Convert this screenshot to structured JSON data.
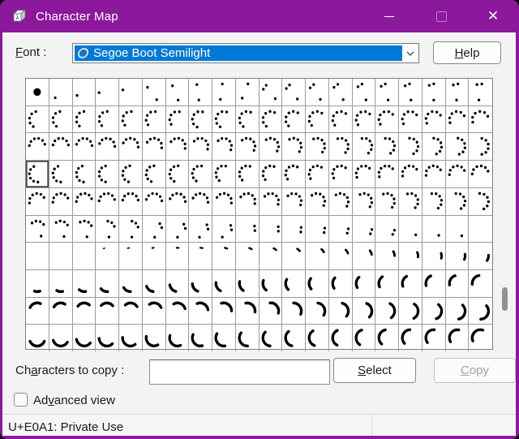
{
  "titlebar": {
    "title": "Character Map",
    "minimize_glyph": "–",
    "close_glyph": "✕"
  },
  "font_row": {
    "label": {
      "pre": "",
      "key": "F",
      "post": "ont :"
    },
    "combo_value": "Segoe Boot Semilight",
    "help_button": {
      "pre": "",
      "key": "H",
      "post": "elp"
    }
  },
  "colors": {
    "accent": "#8C199C",
    "selection_highlight": "#0078D7",
    "glyph": "#000000"
  },
  "grid": {
    "columns": 20,
    "rows": 10,
    "selected_index": 60,
    "cells": [
      "B",
      "d:225",
      "d:245",
      "d:265",
      "d:285",
      "d:305,160",
      "d:320,175",
      "d:335,190",
      "d:350,205",
      "d:5,220",
      "d:290,325,145",
      "d:295,330,150",
      "d:300,335,155",
      "d:305,340,160",
      "d:310,345,165",
      "d:315,350,170",
      "d:320,355,175",
      "d:325,0,180",
      "d:330,5,185",
      "d:335,10,190",
      "d:350,315,280,245,210",
      "d:354,319,284,249,214",
      "d:358,323,288,253,218",
      "d:2,327,292,257,222",
      "d:6,331,296,261,226",
      "d:10,335,300,265,230",
      "d:14,339,304,269,234",
      "d:18,343,308,273,238,203",
      "d:22,347,312,277,242,207",
      "d:26,351,316,281,246,211",
      "d:30,355,320,285,250,215",
      "d:34,359,324,289,254,219",
      "d:38,3,328,293,258,223",
      "d:42,7,332,297,262,227",
      "d:46,11,336,301,266,231",
      "d:50,15,340,305,270,235",
      "d:54,19,344,309,274,239",
      "d:58,23,348,313,278,243",
      "d:62,27,352,317,282,247",
      "d:66,31,356,321,286,251",
      "d:75,43,11,339,307,275",
      "d:80,48,16,344,312,280",
      "d:85,53,21,349,317,285",
      "d:90,58,26,354,322,290",
      "d:95,63,31,359,327,295",
      "d:100,68,36,4,332,300",
      "d:105,73,41,9,337,305",
      "d:110,78,46,14,342,310",
      "d:115,83,51,19,347,315",
      "d:120,88,56,24,352,320",
      "d:125,93,61,29,357,325",
      "d:130,98,66,34,2,330",
      "d:135,103,71,39,7,335",
      "d:140,108,76,44,12,340",
      "d:145,113,81,49,17,345",
      "d:150,118,86,54,22,350",
      "d:155,123,91,59,27,355",
      "d:160,128,96,64,32,0",
      "d:165,133,101,69,37,5",
      "d:170,138,106,74,42,10",
      "d:335,303,271,239,207,175",
      "d:340,308,276,244,212,180",
      "d:345,313,281,249,217,185",
      "d:350,318,286,254,222,190",
      "d:355,323,291,259,227,195",
      "d:0,328,296,264,232,200",
      "d:5,333,301,269,237,205",
      "d:10,338,306,274,242,210",
      "d:15,343,311,279,247,215",
      "d:20,348,316,284,252,220",
      "d:25,353,321,289,257,225",
      "d:30,358,326,294,262,230",
      "d:35,3,331,299,267,235",
      "d:40,8,336,304,272,240",
      "d:45,13,341,309,277,245",
      "d:50,18,346,314,282,250",
      "d:55,23,351,319,287,255",
      "d:60,28,356,324,292,260",
      "d:65,33,1,329,297,265",
      "d:70,38,6,334,302,270",
      "d:60,28,356,324,292,260",
      "d:65,33,1,329,297,265",
      "d:70,38,6,334,302,270",
      "d:75,43,11,339,307,275",
      "d:80,48,16,344,312,280",
      "d:85,53,21,349,317,285",
      "d:90,58,26,354,322,290",
      "d:95,63,31,359,327,295",
      "d:100,68,36,4,332,300",
      "d:105,73,41,9,337,305",
      "d:110,78,46,14,342,310",
      "d:115,83,51,19,347,315",
      "d:120,88,56,24,352,320",
      "d:125,93,61,29,357,325",
      "d:130,98,66,34,2,330",
      "d:135,103,71,39,7,335",
      "d:140,108,76,44,12,340",
      "d:145,113,81,49,17,345",
      "d:150,118,86,54,22,350",
      "d:155,123,91,59,27,355",
      "d:55,23,351,319,150",
      "d:60,28,356,324,155",
      "d:65,33,1,329,160",
      "d:70,38,6,165",
      "d:75,43,11,170",
      "d:80,48,175",
      "d:85,53,180",
      "d:90,58,185",
      "d:95,63,190",
      "d:68,100",
      "d:73,105",
      "d:78,110",
      "d:83,115",
      "d:88,120",
      "d:93,125",
      "d:98,130",
      "d:135",
      "d:140",
      "d:145",
      "",
      "",
      "",
      "",
      "a:334,342,1.6",
      "a:340,350,1.8",
      "a:347,359,2.0",
      "a:354,8,2.2",
      "a:1,17,2.3",
      "a:8,26,2.4",
      "a:15,35,2.5",
      "a:22,44,2.6",
      "a:29,53,2.7",
      "a:36,62,2.8",
      "a:43,71,2.9",
      "a:50,80,3.0",
      "a:57,89,3.0",
      "a:64,98,3.1",
      "a:71,107,3.1",
      "a:78,116,3.2",
      "a:85,125,3.2",
      "a:160,200",
      "a:165,210",
      "a:170,220",
      "a:175,230",
      "a:180,240",
      "a:186,250",
      "a:192,260",
      "a:198,268",
      "a:204,276",
      "a:210,284",
      "a:216,292",
      "a:222,300",
      "a:228,308",
      "a:234,314",
      "a:240,320",
      "a:245,326",
      "a:250,332",
      "a:255,338",
      "a:260,344",
      "a:265,350",
      "a:295,25",
      "a:301,33",
      "a:307,41",
      "a:313,49",
      "a:319,57",
      "a:325,65",
      "a:331,73",
      "a:337,81",
      "a:343,89",
      "a:349,97",
      "a:355,105",
      "a:1,113",
      "a:7,121",
      "a:13,129",
      "a:19,137",
      "a:25,145",
      "a:31,153",
      "a:37,161",
      "a:43,169",
      "a:49,177",
      "a:115,245",
      "a:122,252",
      "a:129,259",
      "a:136,266",
      "a:143,273",
      "a:150,280",
      "a:157,287",
      "a:164,294",
      "a:171,301",
      "a:178,308",
      "a:185,315",
      "a:192,322",
      "a:199,329",
      "a:206,336",
      "a:213,343",
      "a:220,350",
      "a:227,357",
      "a:234,4",
      "a:241,11",
      "a:248,18"
    ]
  },
  "copy_row": {
    "label": {
      "pre": "Ch",
      "key": "a",
      "post": "racters to copy :"
    },
    "input_value": "",
    "select_button": {
      "pre": "",
      "key": "S",
      "post": "elect"
    },
    "copy_button": {
      "pre": "",
      "key": "C",
      "post": "opy"
    }
  },
  "advanced": {
    "label": {
      "pre": "Ad",
      "key": "v",
      "post": "anced view"
    },
    "checked": false
  },
  "statusbar": {
    "text": "U+E0A1: Private Use"
  }
}
